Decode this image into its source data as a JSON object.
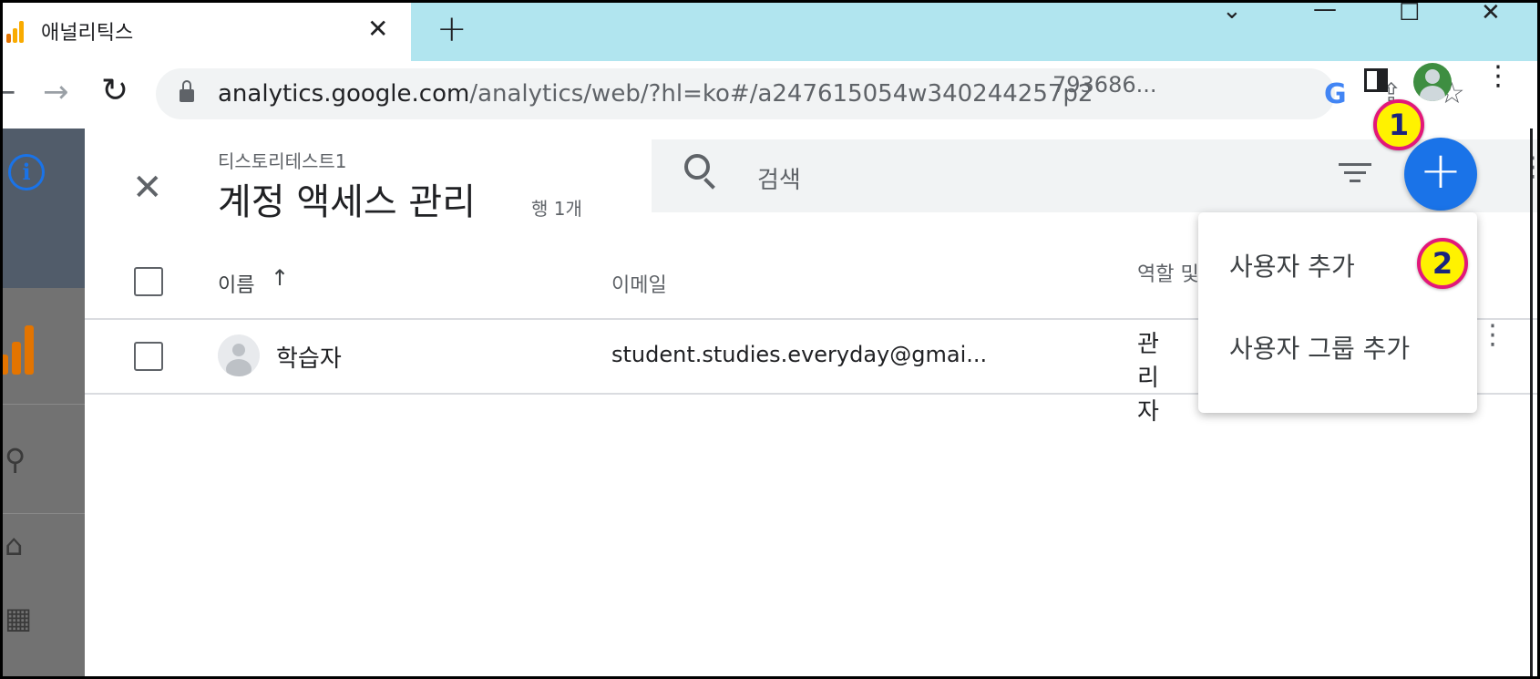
{
  "browser": {
    "tab_title": "애널리틱스",
    "tab_close": "✕",
    "new_tab": "+",
    "window_controls": {
      "dropdown": "⌄",
      "minimize": "—",
      "maximize": "☐",
      "close": "✕"
    },
    "nav": {
      "back": "←",
      "forward": "→",
      "reload": "↻"
    },
    "url_host": "analytics.google.com",
    "url_path": "/analytics/web/?hl=ko#/a247615054w340244257p2",
    "url_trail": "793686...",
    "google_icon": "G",
    "share_icon": "⇪",
    "star_icon": "☆",
    "menu_icon": "⋮"
  },
  "background": {
    "info_icon": "i",
    "search_icon": "⚲",
    "home_icon": "⌂",
    "explore_icon": "▦"
  },
  "panel": {
    "close_icon": "✕",
    "account_name": "티스토리테스트1",
    "title": "계정 액세스 관리",
    "row_count": "행 1개",
    "search_placeholder": "검색",
    "columns": {
      "name": "이름",
      "sort_icon": "↑",
      "email": "이메일",
      "role": "역할 및 데이터"
    },
    "rows": [
      {
        "name": "학습자",
        "email": "student.studies.everyday@gmai...",
        "role": "관리자"
      }
    ],
    "row_more": "⋮",
    "edge_more": "⋮",
    "fab_label": "+"
  },
  "menu": {
    "items": [
      "사용자 추가",
      "사용자 그룹 추가"
    ]
  },
  "annotations": {
    "badge1": "1",
    "badge2": "2"
  },
  "colors": {
    "accent": "#1a73e8",
    "badge_fill": "#fff200",
    "badge_border": "#e2187a"
  }
}
